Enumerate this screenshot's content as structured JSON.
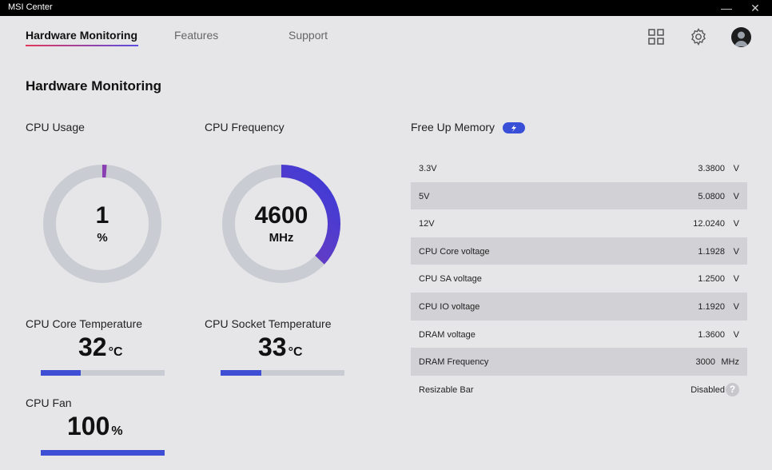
{
  "window": {
    "title": "MSI Center",
    "minimize_glyph": "—",
    "close_glyph": "✕"
  },
  "nav": {
    "tabs": [
      {
        "label": "Hardware Monitoring",
        "active": true
      },
      {
        "label": "Features",
        "active": false
      },
      {
        "label": "Support",
        "active": false
      }
    ],
    "icons": [
      "grid-icon",
      "gear-icon",
      "avatar"
    ]
  },
  "main": {
    "title": "Hardware Monitoring",
    "cpu_usage": {
      "label": "CPU Usage",
      "value": "1",
      "unit": "%",
      "fraction": 0.01
    },
    "cpu_frequency": {
      "label": "CPU Frequency",
      "value": "4600",
      "unit": "MHz",
      "fraction": 0.37
    },
    "cpu_core_temp": {
      "label": "CPU Core Temperature",
      "value": "32",
      "unit": "°C",
      "fraction": 0.32
    },
    "cpu_socket_temp": {
      "label": "CPU Socket Temperature",
      "value": "33",
      "unit": "°C",
      "fraction": 0.33
    },
    "cpu_fan": {
      "label": "CPU Fan",
      "value": "100",
      "unit": "%",
      "fraction": 1.0
    },
    "free_memory": {
      "label": "Free Up Memory"
    },
    "voltages": [
      {
        "name": "3.3V",
        "value": "3.3800",
        "unit": "V"
      },
      {
        "name": "5V",
        "value": "5.0800",
        "unit": "V"
      },
      {
        "name": "12V",
        "value": "12.0240",
        "unit": "V"
      },
      {
        "name": "CPU Core voltage",
        "value": "1.1928",
        "unit": "V"
      },
      {
        "name": "CPU SA voltage",
        "value": "1.2500",
        "unit": "V"
      },
      {
        "name": "CPU IO voltage",
        "value": "1.1920",
        "unit": "V"
      },
      {
        "name": "DRAM voltage",
        "value": "1.3600",
        "unit": "V"
      },
      {
        "name": "DRAM Frequency",
        "value": "3000",
        "unit": "MHz"
      },
      {
        "name": "Resizable Bar",
        "value": "Disabled",
        "unit": ""
      }
    ]
  },
  "colors": {
    "accent": "#3e4fd6",
    "gauge_track": "#c9ccd2",
    "gauge_start": "#8a3fb2",
    "gauge_end": "#3a3ad8"
  }
}
